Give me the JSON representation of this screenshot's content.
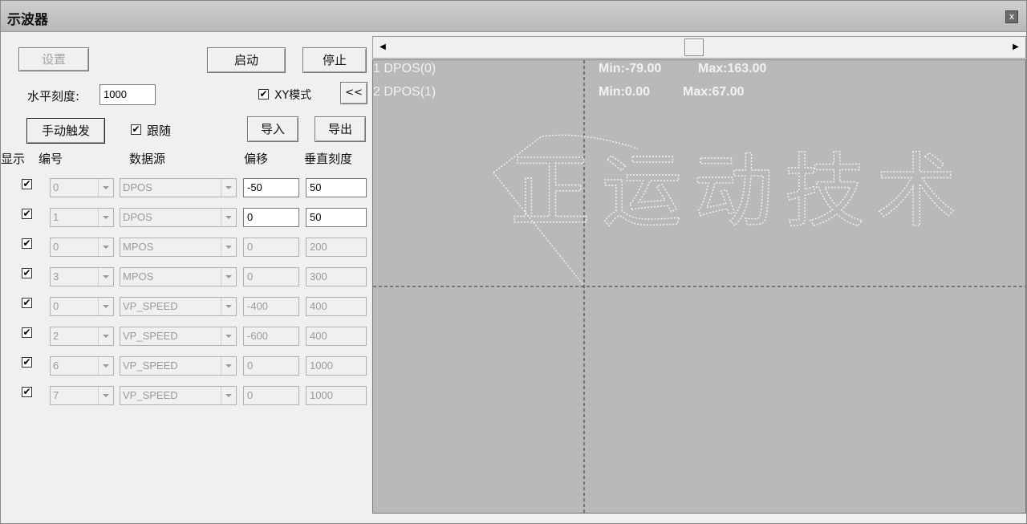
{
  "window": {
    "title": "示波器",
    "close_label": "x"
  },
  "toolbar": {
    "settings_label": "设置",
    "start_label": "启动",
    "stop_label": "停止",
    "horizontal_scale_label": "水平刻度:",
    "horizontal_scale_value": "1000",
    "xy_mode_label": "XY模式",
    "xy_mode_checked": true,
    "collapse_label": "<<",
    "manual_trigger_label": "手动触发",
    "follow_label": "跟随",
    "follow_checked": true,
    "import_label": "导入",
    "export_label": "导出"
  },
  "table": {
    "headers": {
      "show": "显示",
      "number": "编号",
      "source": "数据源",
      "offset": "偏移",
      "vscale": "垂直刻度"
    },
    "rows": [
      {
        "checked": true,
        "number": "0",
        "source": "DPOS",
        "offset": "-50",
        "vscale": "50",
        "editable": true
      },
      {
        "checked": true,
        "number": "1",
        "source": "DPOS",
        "offset": "0",
        "vscale": "50",
        "editable": true
      },
      {
        "checked": true,
        "number": "0",
        "source": "MPOS",
        "offset": "0",
        "vscale": "200",
        "editable": false
      },
      {
        "checked": true,
        "number": "3",
        "source": "MPOS",
        "offset": "0",
        "vscale": "300",
        "editable": false
      },
      {
        "checked": true,
        "number": "0",
        "source": "VP_SPEED",
        "offset": "-400",
        "vscale": "400",
        "editable": false
      },
      {
        "checked": true,
        "number": "2",
        "source": "VP_SPEED",
        "offset": "-600",
        "vscale": "400",
        "editable": false
      },
      {
        "checked": true,
        "number": "6",
        "source": "VP_SPEED",
        "offset": "0",
        "vscale": "1000",
        "editable": false
      },
      {
        "checked": true,
        "number": "7",
        "source": "VP_SPEED",
        "offset": "0",
        "vscale": "1000",
        "editable": false
      }
    ]
  },
  "scope": {
    "channels": [
      {
        "label": "1 DPOS(0)",
        "min": "Min:-79.00",
        "max": "Max:163.00"
      },
      {
        "label": "2 DPOS(1)",
        "min": "Min:0.00",
        "max": "Max:67.00"
      }
    ],
    "trace_text": "正运动技术",
    "colors": {
      "plot_bg": "#b9b9b9",
      "trace": "#f2f2f2",
      "grid": "#333333"
    }
  }
}
